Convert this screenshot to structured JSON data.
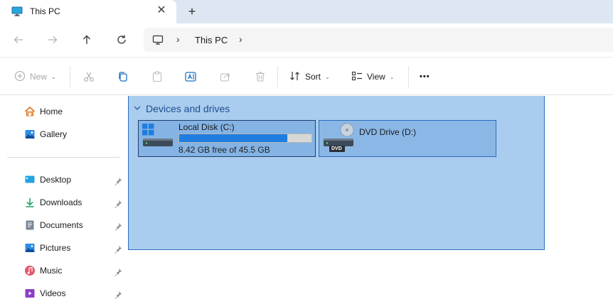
{
  "tab": {
    "title": "This PC",
    "close_glyph": "✕",
    "new_tab_glyph": "+"
  },
  "address": {
    "location": "This PC",
    "chevron": "›"
  },
  "toolbar": {
    "new_label": "New",
    "sort_label": "Sort",
    "view_label": "View",
    "more_label": "•••"
  },
  "sidebar": {
    "items": [
      {
        "label": "Home",
        "icon": "home-icon"
      },
      {
        "label": "Gallery",
        "icon": "gallery-icon"
      },
      {
        "label": "Desktop",
        "icon": "desktop-icon",
        "pinned": true
      },
      {
        "label": "Downloads",
        "icon": "downloads-icon",
        "pinned": true
      },
      {
        "label": "Documents",
        "icon": "documents-icon",
        "pinned": true
      },
      {
        "label": "Pictures",
        "icon": "pictures-icon",
        "pinned": true
      },
      {
        "label": "Music",
        "icon": "music-icon",
        "pinned": true
      },
      {
        "label": "Videos",
        "icon": "videos-icon",
        "pinned": true
      }
    ]
  },
  "content": {
    "group_title": "Devices and drives",
    "drives": [
      {
        "name": "Local Disk (C:)",
        "free_text": "8.42 GB free of 45.5 GB",
        "used_fraction": 0.815
      },
      {
        "name": "DVD Drive (D:)",
        "badge": "DVD"
      }
    ]
  },
  "colors": {
    "accent": "#1f7ddf",
    "selection": "#a9ccef",
    "tabstrip": "#dce7f3"
  }
}
